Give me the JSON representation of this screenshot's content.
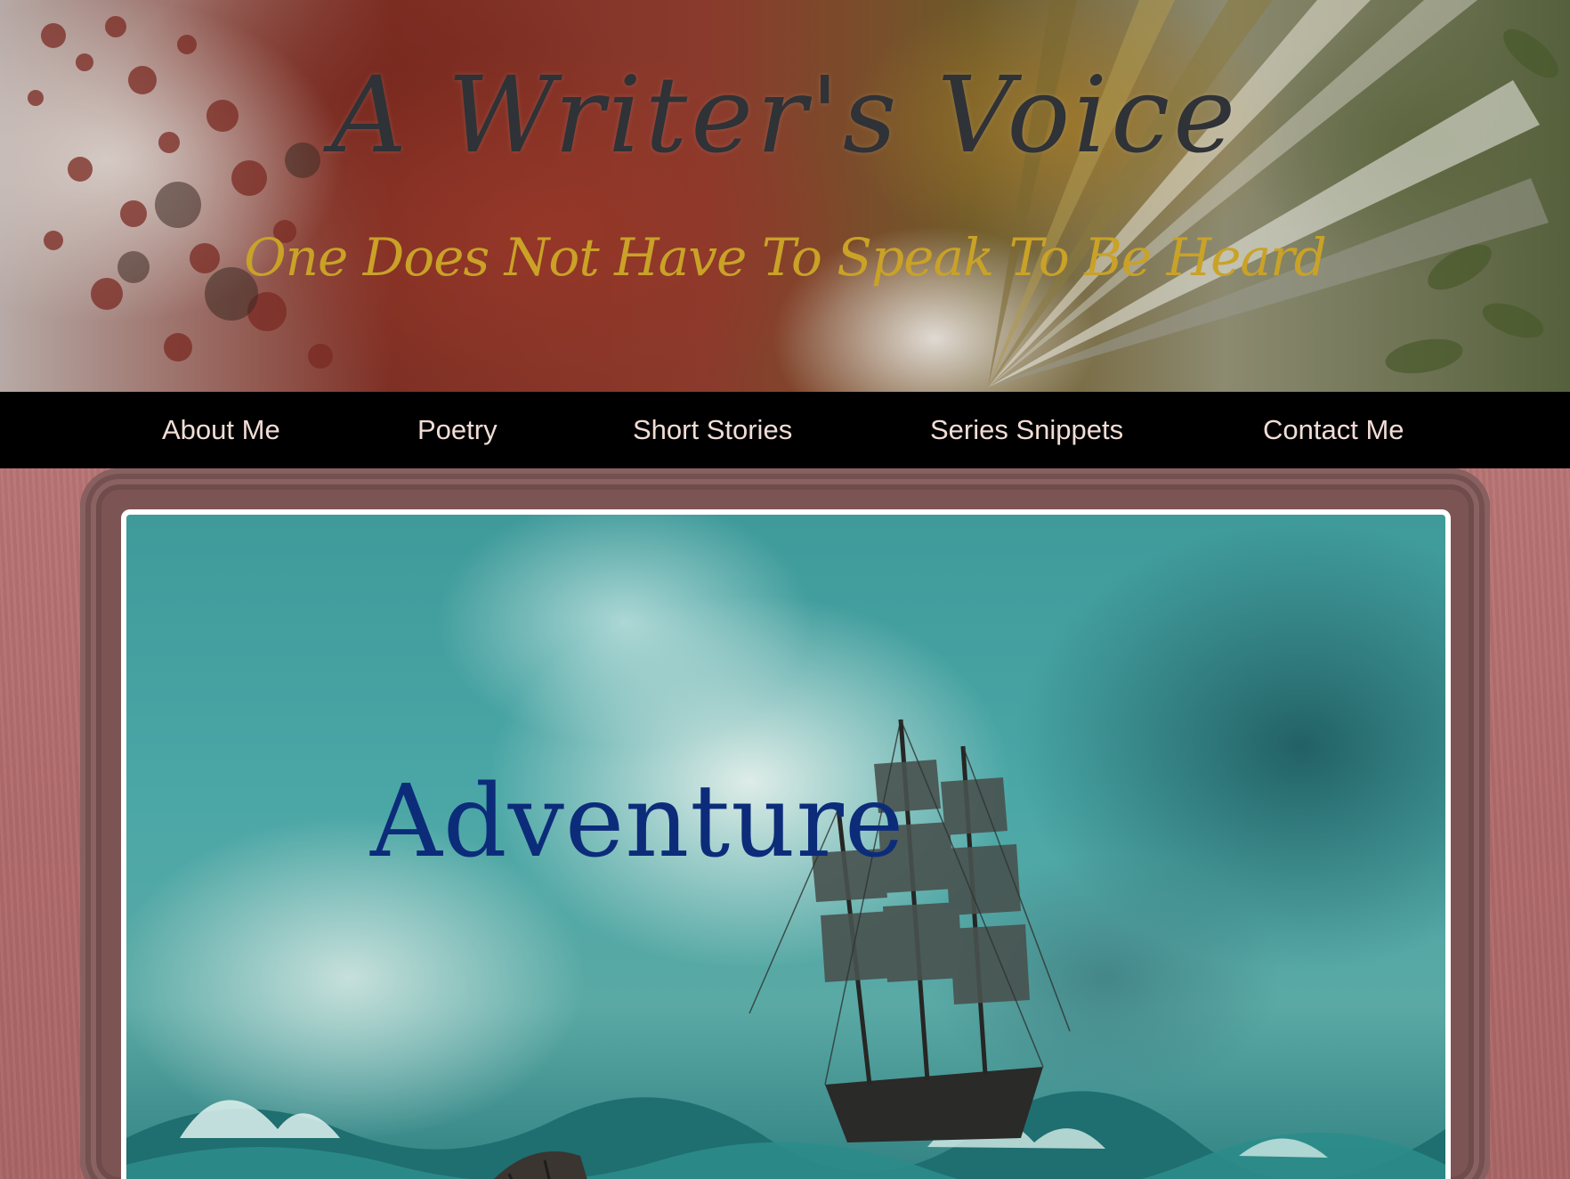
{
  "header": {
    "site_title": "A Writer's Voice",
    "tagline": "One Does Not Have To Speak To Be Heard"
  },
  "nav": {
    "items": [
      {
        "label": "About Me"
      },
      {
        "label": "Poetry"
      },
      {
        "label": "Short Stories"
      },
      {
        "label": "Series Snippets"
      },
      {
        "label": "Contact Me"
      }
    ]
  },
  "hero": {
    "title": "Adventure",
    "image_subject": "sailing-ship-in-stormy-sea"
  },
  "colors": {
    "nav_background": "#000000",
    "nav_text": "#f1ddd5",
    "title_color": "#2f3236",
    "tagline_color": "#c9a227",
    "page_background": "#b06a6a",
    "frame_color": "#7d5454",
    "hero_title_color": "#0c2c7a"
  }
}
